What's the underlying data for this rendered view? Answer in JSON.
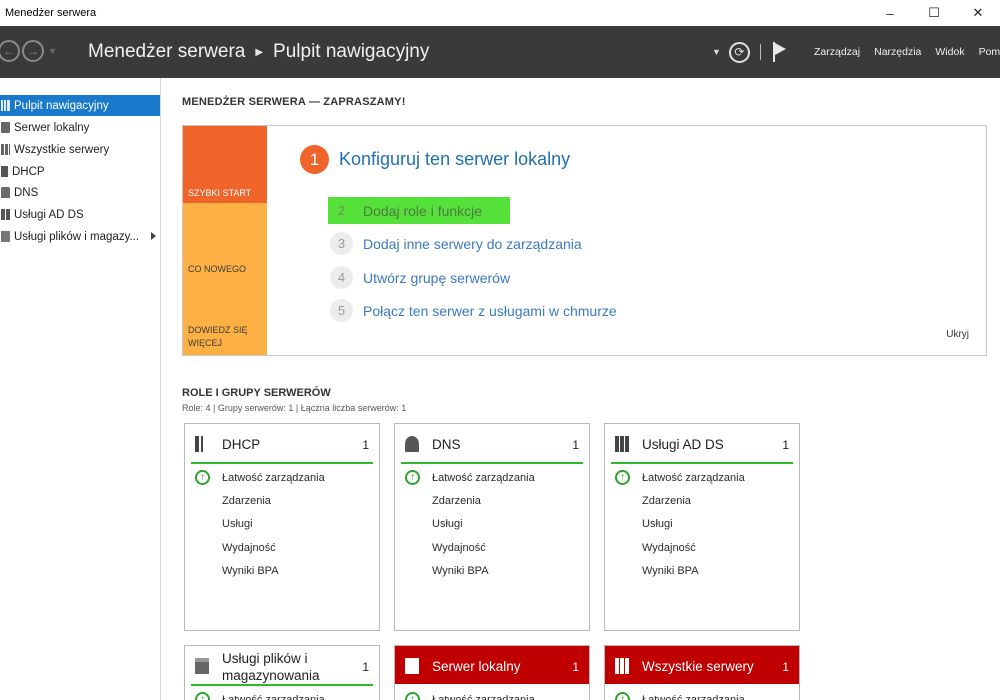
{
  "window": {
    "title": "Menedżer serwera",
    "minimize_icon": "–",
    "maximize_icon": "☐",
    "close_icon": "✕"
  },
  "header": {
    "breadcrumb_app": "Menedżer serwera",
    "breadcrumb_page": "Pulpit nawigacyjny",
    "menus": [
      "Zarządzaj",
      "Narzędzia",
      "Widok",
      "Pomoc"
    ]
  },
  "sidebar": {
    "items": [
      {
        "label": "Pulpit nawigacyjny",
        "icon": "dashboard-icon",
        "active": true
      },
      {
        "label": "Serwer lokalny",
        "icon": "server-icon"
      },
      {
        "label": "Wszystkie serwery",
        "icon": "servers-icon"
      },
      {
        "label": "DHCP",
        "icon": "dhcp-icon"
      },
      {
        "label": "DNS",
        "icon": "dns-icon"
      },
      {
        "label": "Usługi AD DS",
        "icon": "ad-ds-icon"
      },
      {
        "label": "Usługi plików i magazy...",
        "icon": "file-services-icon",
        "has_submenu": true
      }
    ]
  },
  "welcome": {
    "title": "MENEDŻER SERWERA — ZAPRASZAMY!",
    "tiles": [
      "SZYBKI START",
      "CO NOWEGO",
      "DOWIEDZ SIĘ WIĘCEJ"
    ],
    "main_step": {
      "num": "1",
      "label": "Konfiguruj ten serwer lokalny"
    },
    "steps": [
      {
        "num": "2",
        "label": "Dodaj role i funkcje",
        "highlighted": true
      },
      {
        "num": "3",
        "label": "Dodaj inne serwery do zarządzania"
      },
      {
        "num": "4",
        "label": "Utwórz grupę serwerów"
      },
      {
        "num": "5",
        "label": "Połącz ten serwer z usługami w chmurze"
      }
    ],
    "hide_label": "Ukryj"
  },
  "roles": {
    "title": "ROLE I GRUPY SERWERÓW",
    "subtitle": "Role: 4 | Grupy serwerów: 1 | Łączna liczba serwerów: 1",
    "row_labels": [
      "Łatwość zarządzania",
      "Zdarzenia",
      "Usługi",
      "Wydajność",
      "Wyniki BPA"
    ],
    "cards": [
      {
        "name": "DHCP",
        "count": "1",
        "icon": "dhcp-icon",
        "status": "ok"
      },
      {
        "name": "DNS",
        "count": "1",
        "icon": "dns-icon",
        "status": "ok"
      },
      {
        "name": "Usługi AD DS",
        "count": "1",
        "icon": "ad-ds-icon",
        "status": "ok"
      },
      {
        "name": "Usługi plików i magazynowania",
        "count": "1",
        "icon": "file-services-icon",
        "status": "ok"
      },
      {
        "name": "Serwer lokalny",
        "count": "1",
        "icon": "server-icon",
        "status": "alert"
      },
      {
        "name": "Wszystkie serwery",
        "count": "1",
        "icon": "servers-icon",
        "status": "alert"
      }
    ]
  },
  "colors": {
    "header_bg": "#3a3a3a",
    "active_nav": "#1979ca",
    "quickstart_orange": "#f0642a",
    "tile_yellow": "#fdb043",
    "link_blue": "#1f6fb5",
    "highlight_green": "#55e03a",
    "status_green": "#2bbb2b",
    "alert_red": "#c00000"
  }
}
